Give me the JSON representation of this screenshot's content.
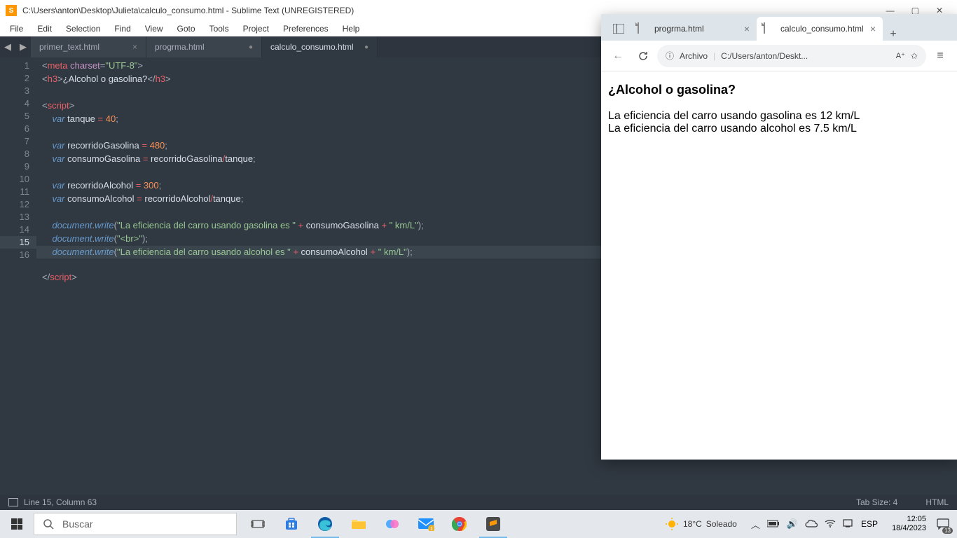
{
  "sublime": {
    "title": "C:\\Users\\anton\\Desktop\\Julieta\\calculo_consumo.html - Sublime Text (UNREGISTERED)",
    "menu": [
      "File",
      "Edit",
      "Selection",
      "Find",
      "View",
      "Goto",
      "Tools",
      "Project",
      "Preferences",
      "Help"
    ],
    "tabs": [
      {
        "label": "primer_text.html",
        "active": false,
        "close": "×"
      },
      {
        "label": "progrma.html",
        "active": false,
        "close": "●"
      },
      {
        "label": "calculo_consumo.html",
        "active": true,
        "close": "●"
      }
    ],
    "status_left": "Line 15, Column 63",
    "status_tab": "Tab Size: 4",
    "status_lang": "HTML",
    "code": {
      "lines": 16,
      "current": 15
    }
  },
  "code_text": {
    "l1a": "meta",
    "l1b": "charset",
    "l1c": "\"UTF-8\"",
    "l2a": "h3",
    "l2b": "¿Alcohol o gasolina?",
    "l2c": "h3",
    "l4a": "script",
    "l5a": "var",
    "l5b": "tanque",
    "l5c": "40",
    "l7a": "var",
    "l7b": "recorridoGasolina",
    "l7c": "480",
    "l8a": "var",
    "l8b": "consumoGasolina",
    "l8c": "recorridoGasolina",
    "l8d": "tanque",
    "l10a": "var",
    "l10b": "recorridoAlcohol",
    "l10c": "300",
    "l11a": "var",
    "l11b": "consumoAlcohol",
    "l11c": "recorridoAlcohol",
    "l11d": "tanque",
    "l13a": "document",
    "l13b": "write",
    "l13c": "\"La eficiencia del carro usando gasolina es \"",
    "l13d": "consumoGasolina",
    "l13e": "\" km/L\"",
    "l14a": "document",
    "l14b": "write",
    "l14c": "\"<br>\"",
    "l15a": "document",
    "l15b": "write",
    "l15c": "\"La eficiencia del carro usando alcohol es \"",
    "l15d": "consumoAlcohol",
    "l15e": "\" km/L\"",
    "l16a": "script"
  },
  "edge": {
    "tab1": "progrma.html",
    "tab2": "calculo_consumo.html",
    "addr_label": "Archivo",
    "addr_path": "C:/Users/anton/Deskt..."
  },
  "page": {
    "heading": "¿Alcohol o gasolina?",
    "line1": "La eficiencia del carro usando gasolina es 12 km/L",
    "line2": "La eficiencia del carro usando alcohol es 7.5 km/L"
  },
  "taskbar": {
    "search_placeholder": "Buscar",
    "weather_temp": "18°C",
    "weather_cond": "Soleado",
    "lang": "ESP",
    "time": "12:05",
    "date": "18/4/2023",
    "notif_count": "13"
  }
}
